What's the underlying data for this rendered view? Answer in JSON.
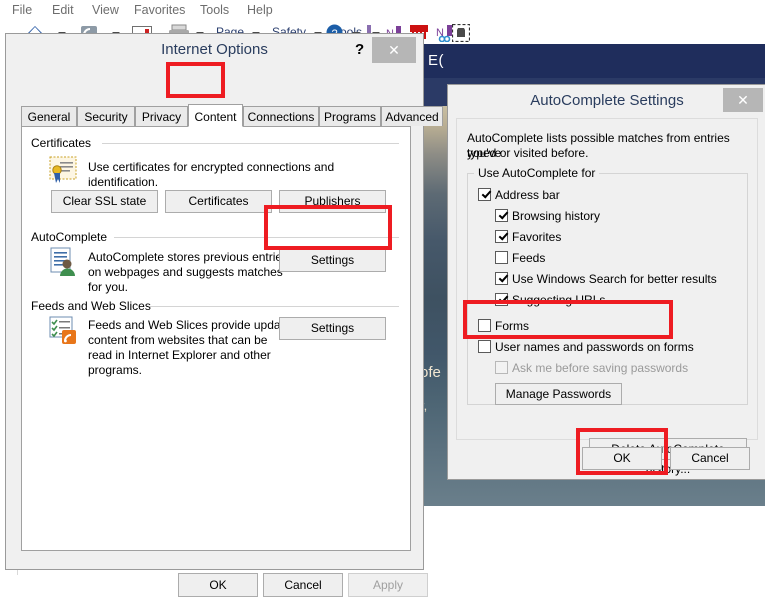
{
  "browser": {
    "menu": [
      "File",
      "Edit",
      "View",
      "Favorites",
      "Tools",
      "Help"
    ],
    "toolbar_text": [
      "Page",
      "Safety",
      "Tools"
    ],
    "toolbar_icons": [
      "home-icon",
      "feeds-icon",
      "read-mail-icon",
      "print-icon",
      "page-menu-icon",
      "safety-menu-icon",
      "tools-menu-icon",
      "help-icon",
      "onenote-pen-icon",
      "onenote-icon",
      "bookmark-icon",
      "onenote-linked-icon",
      "evernote-clipper-icon"
    ]
  },
  "background_page": {
    "brand": "E(",
    "hero_line1": "ofe",
    "hero_line2": "r,"
  },
  "internet_options": {
    "title": "Internet Options",
    "help_glyph": "?",
    "close_glyph": "✕",
    "tabs": [
      {
        "label": "General",
        "selected": false
      },
      {
        "label": "Security",
        "selected": false
      },
      {
        "label": "Privacy",
        "selected": false
      },
      {
        "label": "Content",
        "selected": true
      },
      {
        "label": "Connections",
        "selected": false
      },
      {
        "label": "Programs",
        "selected": false
      },
      {
        "label": "Advanced",
        "selected": false
      }
    ],
    "certificates": {
      "group_label": "Certificates",
      "icon": "certificate-icon",
      "description": "Use certificates for encrypted connections and identification.",
      "buttons": [
        "Clear SSL state",
        "Certificates",
        "Publishers"
      ]
    },
    "autocomplete": {
      "group_label": "AutoComplete",
      "icon": "autocomplete-icon",
      "description_line1": "AutoComplete stores previous entries",
      "description_line2": "on webpages and suggests matches",
      "description_line3": "for you.",
      "settings_button": "Settings"
    },
    "feeds": {
      "group_label": "Feeds and Web Slices",
      "icon": "feeds-webslices-icon",
      "description_line1": "Feeds and Web Slices provide updated",
      "description_line2": "content from websites that can be",
      "description_line3": "read in Internet Explorer and other",
      "description_line4": "programs.",
      "settings_button": "Settings"
    },
    "footer": {
      "ok": "OK",
      "cancel": "Cancel",
      "apply": "Apply"
    }
  },
  "autocomplete_settings": {
    "title": "AutoComplete Settings",
    "close_glyph": "✕",
    "intro_line1": "AutoComplete lists possible matches from entries you've",
    "intro_line2": "typed or visited before.",
    "group_label": "Use AutoComplete for",
    "options": [
      {
        "label": "Address bar",
        "checked": true,
        "enabled": true,
        "indent": 0
      },
      {
        "label": "Browsing history",
        "checked": true,
        "enabled": true,
        "indent": 1
      },
      {
        "label": "Favorites",
        "checked": true,
        "enabled": true,
        "indent": 1
      },
      {
        "label": "Feeds",
        "checked": false,
        "enabled": true,
        "indent": 1
      },
      {
        "label": "Use Windows Search for better results",
        "checked": true,
        "enabled": true,
        "indent": 1
      },
      {
        "label": "Suggesting URLs",
        "checked": true,
        "enabled": true,
        "indent": 1
      },
      {
        "label": "Forms",
        "checked": false,
        "enabled": true,
        "indent": 0
      },
      {
        "label": "User names and passwords on forms",
        "checked": false,
        "enabled": true,
        "indent": 0
      },
      {
        "label": "Ask me before saving passwords",
        "checked": false,
        "enabled": false,
        "indent": 1
      }
    ],
    "manage_passwords_button": "Manage Passwords",
    "delete_history_button": "Delete AutoComplete history...",
    "ok": "OK",
    "cancel": "Cancel"
  },
  "highlights": {
    "color": "#ee1c22",
    "targets": [
      "content-tab",
      "autocomplete-settings-button",
      "forms-checkbox-group",
      "autocomplete-ok-button"
    ]
  },
  "colors": {
    "dialog_bg": "#f0f0f0",
    "title_text": "#2a3d5e",
    "page_header": "#1f2d5c",
    "accent_red": "#ee1c22",
    "button_face": "#efefef",
    "disabled_text": "#a0a0a0"
  }
}
